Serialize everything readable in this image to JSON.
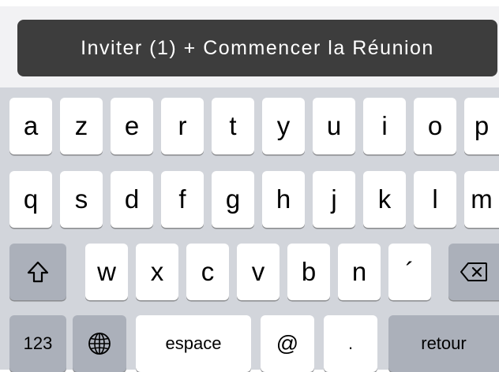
{
  "button": {
    "label": "Inviter (1) + Commencer la Réunion"
  },
  "keyboard": {
    "row1": [
      "a",
      "z",
      "e",
      "r",
      "t",
      "y",
      "u",
      "i",
      "o",
      "p"
    ],
    "row2": [
      "q",
      "s",
      "d",
      "f",
      "g",
      "h",
      "j",
      "k",
      "l",
      "m"
    ],
    "row3": [
      "w",
      "x",
      "c",
      "v",
      "b",
      "n",
      "´"
    ],
    "numbers_label": "123",
    "space_label": "espace",
    "at_label": "@",
    "dot_label": ".",
    "return_label": "retour",
    "icons": {
      "shift": "shift-icon",
      "backspace": "backspace-icon",
      "globe": "globe-icon"
    }
  },
  "colors": {
    "button_bg": "#3d3d3d",
    "keyboard_bg": "#d2d5db",
    "key_light": "#ffffff",
    "key_dark": "#abb0ba"
  }
}
